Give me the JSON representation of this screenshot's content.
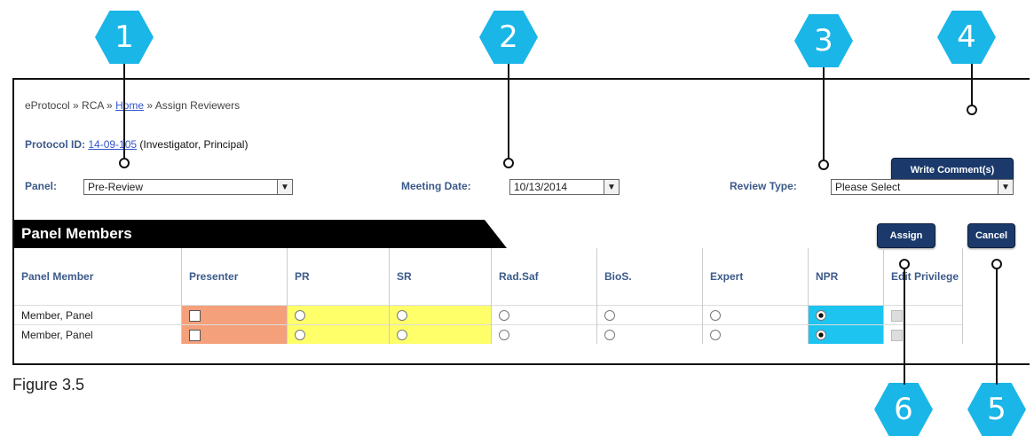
{
  "callouts": [
    "1",
    "2",
    "3",
    "4",
    "5",
    "6"
  ],
  "breadcrumb": {
    "part1": "eProtocol » RCA » ",
    "home": "Home",
    "part2": " » Assign Reviewers"
  },
  "protocol": {
    "label": "Protocol ID: ",
    "id": "14-09-105",
    "role": "(Investigator, Principal)"
  },
  "buttons": {
    "write_comment": "Write Comment(s)",
    "assign": "Assign",
    "cancel": "Cancel"
  },
  "filters": {
    "panel_label": "Panel:",
    "panel_value": "Pre-Review",
    "meeting_label": "Meeting Date:",
    "meeting_value": "10/13/2014",
    "review_label": "Review Type:",
    "review_value": "Please Select"
  },
  "section_title": "Panel Members",
  "table": {
    "headers": [
      "Panel Member",
      "Presenter",
      "PR",
      "SR",
      "Rad.Saf",
      "BioS.",
      "Expert",
      "NPR",
      "Edit Privilege"
    ],
    "rows": [
      {
        "name": "Member, Panel",
        "npr_selected": true
      },
      {
        "name": "Member, Panel",
        "npr_selected": true
      }
    ]
  },
  "caption": "Figure 3.5",
  "colors": {
    "callout": "#1ab6e8",
    "presenter": "#f4a07b",
    "reviewer": "#ffff6a",
    "npr": "#1ec4f0",
    "button": "#1b3a6b"
  }
}
